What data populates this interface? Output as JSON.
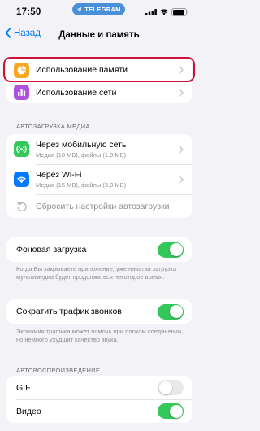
{
  "status_bar": {
    "time": "17:50",
    "app_pill": "TELEGRAM"
  },
  "nav": {
    "back_label": "Назад",
    "title": "Данные и память"
  },
  "usage_group": {
    "items": [
      {
        "label": "Использование памяти",
        "icon": "pie-chart-icon",
        "color": "#f5a623"
      },
      {
        "label": "Использование сети",
        "icon": "bar-chart-icon",
        "color": "#af52de"
      }
    ]
  },
  "autodownload": {
    "header": "АВТОЗАГРУЗКА МЕДИА",
    "items": [
      {
        "label": "Через мобильную сеть",
        "sub": "Медиа (10 MB), файлы (1,0 MB)",
        "icon": "cellular-icon",
        "color": "#34c759"
      },
      {
        "label": "Через Wi-Fi",
        "sub": "Медиа (15 MB), файлы (3,0 MB)",
        "icon": "wifi-icon",
        "color": "#007aff"
      }
    ],
    "reset_label": "Сбросить настройки автозагрузки"
  },
  "background": {
    "label": "Фоновая загрузка",
    "enabled": true,
    "footer": "Когда Вы закрываете приложение, уже начатая загрузка мультимедиа будет продолжаться некоторое время."
  },
  "calls": {
    "label": "Сократить трафик звонков",
    "enabled": true,
    "footer": "Экономия трафика может помочь при плохом соединении, но немного ухудшит качество звука."
  },
  "autoplay": {
    "header": "АВТОВОСПРОИЗВЕДЕНИЕ",
    "items": [
      {
        "label": "GIF",
        "enabled": false
      },
      {
        "label": "Видео",
        "enabled": true
      }
    ]
  }
}
